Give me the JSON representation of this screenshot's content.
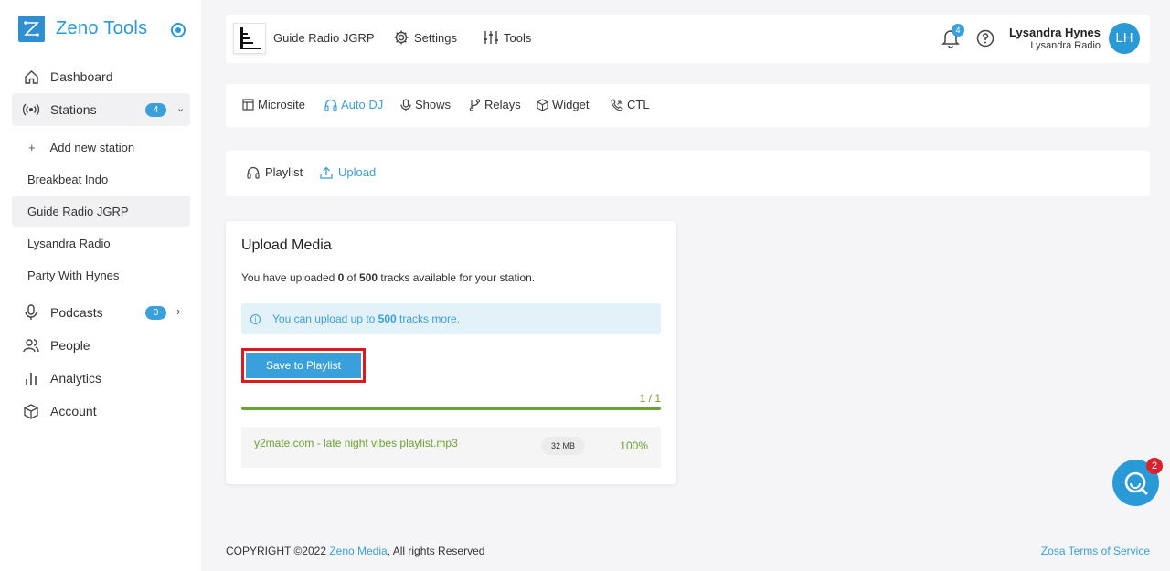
{
  "brand": {
    "name": "Zeno Tools"
  },
  "sidebar": {
    "items": [
      {
        "label": "Dashboard",
        "icon": "home-icon"
      },
      {
        "label": "Stations",
        "icon": "radio-icon",
        "badge": "4"
      },
      {
        "label": "Podcasts",
        "icon": "microphone-icon",
        "badge": "0"
      },
      {
        "label": "People",
        "icon": "people-icon"
      },
      {
        "label": "Analytics",
        "icon": "bar-chart-icon"
      },
      {
        "label": "Account",
        "icon": "cube-icon"
      }
    ],
    "stations": {
      "add_label": "Add new station",
      "list": [
        "Breakbeat Indo",
        "Guide Radio JGRP",
        "Lysandra Radio",
        "Party With Hynes"
      ]
    }
  },
  "header": {
    "station_name": "Guide Radio JGRP",
    "settings_label": "Settings",
    "tools_label": "Tools",
    "notifications_count": "4",
    "user_name": "Lysandra Hynes",
    "user_station": "Lysandra Radio",
    "avatar_initials": "LH"
  },
  "tabs": [
    "Microsite",
    "Auto DJ",
    "Shows",
    "Relays",
    "Widget",
    "CTL"
  ],
  "active_tab": "Auto DJ",
  "subtabs": [
    "Playlist",
    "Upload"
  ],
  "active_subtab": "Upload",
  "upload": {
    "title": "Upload Media",
    "desc_prefix": "You have uploaded ",
    "uploaded": "0",
    "desc_of": " of ",
    "limit": "500",
    "desc_suffix": " tracks available for your station.",
    "info_prefix": "You can upload up to ",
    "info_count": "500",
    "info_suffix": " tracks more.",
    "save_label": "Save to Playlist",
    "progress_count": "1 / 1",
    "progress_fraction": 1.0,
    "file": {
      "name": "y2mate.com - late night vibes playlist.mp3",
      "size": "32 MB",
      "percent": "100%"
    }
  },
  "footer": {
    "copyright_prefix": "COPYRIGHT ©2022 ",
    "company": "Zeno Media",
    "copyright_suffix": ", All rights Reserved",
    "terms": "Zosa Terms of Service"
  },
  "chat": {
    "badge": "2"
  },
  "colors": {
    "accent": "#3aa0db",
    "success": "#6aa233",
    "highlight": "#e0191f"
  }
}
